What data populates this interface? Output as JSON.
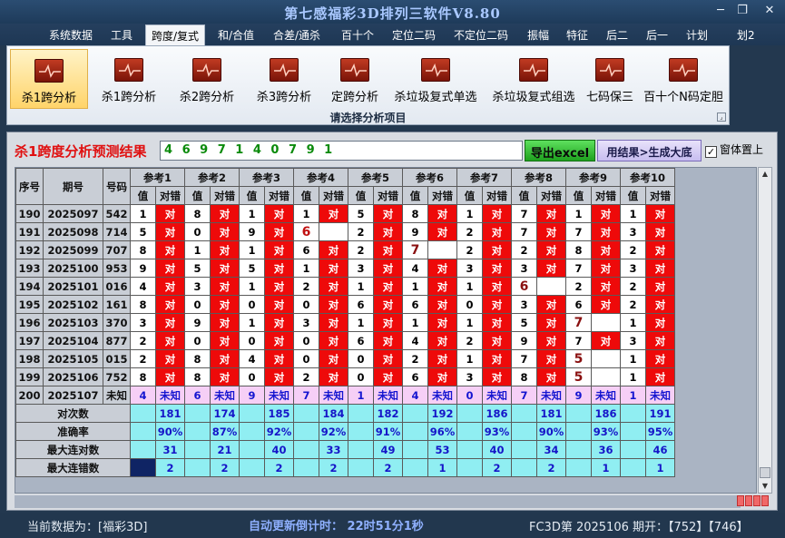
{
  "app": {
    "title": "第七感福彩3D排列三软件V8.80",
    "controls": {
      "minimize": "─",
      "restore": "❐",
      "close": "✕"
    }
  },
  "menu": [
    "系统数据",
    "工具",
    "跨度/复式",
    "和/合值",
    "合差/通杀",
    "百十个",
    "定位二码",
    "不定位二码",
    "振幅",
    "特征",
    "后二",
    "后一",
    "计划",
    "划2"
  ],
  "menu_active_index": 2,
  "ribbon": {
    "buttons": [
      "杀1跨分析",
      "杀1跨分析",
      "杀2跨分析",
      "杀3跨分析",
      "定跨分析",
      "杀垃圾复式单选",
      "杀垃圾复式组选",
      "七码保三",
      "百十个N码定胆"
    ],
    "selected_index": 0,
    "caption": "请选择分析项目"
  },
  "result": {
    "title": "杀1跨度分析预测结果",
    "value": "4 6 9 7 1 4 0 7 9 1",
    "export_button": "导出excel",
    "generate_button": "用结果>生成大底",
    "topmost_label": "窗体置上",
    "topmost_checked": true
  },
  "table": {
    "headers": {
      "seq": "序号",
      "period": "期号",
      "number": "号码",
      "value": "值",
      "check": "对错"
    },
    "ref_names": [
      "参考1",
      "参考2",
      "参考3",
      "参考4",
      "参考5",
      "参考6",
      "参考7",
      "参考8",
      "参考9",
      "参考10"
    ],
    "correct_text": "对",
    "unknown_text": "未知",
    "rows": [
      {
        "seq": "190",
        "period": "2025097",
        "num": "542",
        "vals": [
          "1",
          "8",
          "1",
          "1",
          "5",
          "8",
          "1",
          "7",
          "1",
          "1"
        ],
        "hits": [
          1,
          1,
          1,
          1,
          1,
          1,
          1,
          1,
          1,
          1
        ]
      },
      {
        "seq": "191",
        "period": "2025098",
        "num": "714",
        "vals": [
          "5",
          "0",
          "9",
          "6",
          "2",
          "9",
          "2",
          "7",
          "7",
          "3"
        ],
        "hits": [
          1,
          1,
          1,
          0,
          1,
          1,
          1,
          1,
          1,
          1
        ]
      },
      {
        "seq": "192",
        "period": "2025099",
        "num": "707",
        "vals": [
          "8",
          "1",
          "1",
          "6",
          "2",
          "7",
          "2",
          "2",
          "8",
          "2"
        ],
        "hits": [
          1,
          1,
          1,
          1,
          1,
          0,
          1,
          1,
          1,
          1
        ]
      },
      {
        "seq": "193",
        "period": "2025100",
        "num": "953",
        "vals": [
          "9",
          "5",
          "5",
          "1",
          "3",
          "4",
          "3",
          "3",
          "7",
          "3"
        ],
        "hits": [
          1,
          1,
          1,
          1,
          1,
          1,
          1,
          1,
          1,
          1
        ]
      },
      {
        "seq": "194",
        "period": "2025101",
        "num": "016",
        "vals": [
          "4",
          "3",
          "1",
          "2",
          "1",
          "1",
          "1",
          "6",
          "2",
          "2"
        ],
        "hits": [
          1,
          1,
          1,
          1,
          1,
          1,
          1,
          0,
          1,
          1
        ]
      },
      {
        "seq": "195",
        "period": "2025102",
        "num": "161",
        "vals": [
          "8",
          "0",
          "0",
          "0",
          "6",
          "6",
          "0",
          "3",
          "6",
          "2"
        ],
        "hits": [
          1,
          1,
          1,
          1,
          1,
          1,
          1,
          1,
          1,
          1
        ]
      },
      {
        "seq": "196",
        "period": "2025103",
        "num": "370",
        "vals": [
          "3",
          "9",
          "1",
          "3",
          "1",
          "1",
          "1",
          "5",
          "7",
          "1"
        ],
        "hits": [
          1,
          1,
          1,
          1,
          1,
          1,
          1,
          1,
          0,
          1
        ]
      },
      {
        "seq": "197",
        "period": "2025104",
        "num": "877",
        "vals": [
          "2",
          "0",
          "0",
          "0",
          "6",
          "4",
          "2",
          "9",
          "7",
          "3"
        ],
        "hits": [
          1,
          1,
          1,
          1,
          1,
          1,
          1,
          1,
          1,
          1
        ]
      },
      {
        "seq": "198",
        "period": "2025105",
        "num": "015",
        "vals": [
          "2",
          "8",
          "4",
          "0",
          "0",
          "2",
          "1",
          "7",
          "5",
          "1"
        ],
        "hits": [
          1,
          1,
          1,
          1,
          1,
          1,
          1,
          1,
          0,
          1
        ]
      },
      {
        "seq": "199",
        "period": "2025106",
        "num": "752",
        "vals": [
          "8",
          "8",
          "0",
          "2",
          "0",
          "6",
          "3",
          "8",
          "5",
          "1"
        ],
        "hits": [
          1,
          1,
          1,
          1,
          1,
          1,
          1,
          1,
          0,
          1
        ]
      }
    ],
    "future": {
      "seq": "200",
      "period": "2025107",
      "num": "未知",
      "vals": [
        "4",
        "6",
        "9",
        "7",
        "1",
        "4",
        "0",
        "7",
        "9",
        "1"
      ]
    },
    "stats": [
      {
        "label": "对次数",
        "values": [
          "181",
          "174",
          "185",
          "184",
          "182",
          "192",
          "186",
          "181",
          "186",
          "191"
        ]
      },
      {
        "label": "准确率",
        "values": [
          "90%",
          "87%",
          "92%",
          "92%",
          "91%",
          "96%",
          "93%",
          "90%",
          "93%",
          "95%"
        ]
      },
      {
        "label": "最大连对数",
        "values": [
          "31",
          "21",
          "40",
          "33",
          "49",
          "53",
          "40",
          "34",
          "36",
          "46"
        ]
      },
      {
        "label": "最大连错数",
        "values": [
          "2",
          "2",
          "2",
          "2",
          "2",
          "1",
          "2",
          "2",
          "1",
          "1"
        ]
      }
    ]
  },
  "status": {
    "current_data": "当前数据为：[福彩3D]",
    "countdown": "自动更新倒计时： 22时51分1秒",
    "issue": "FC3D第 2025106 期开：【752】【746】"
  },
  "colors": {
    "hit": "#ee0a0a",
    "unknown": "#f6cff6",
    "stat": "#90eef2",
    "title_red": "#e01010"
  }
}
